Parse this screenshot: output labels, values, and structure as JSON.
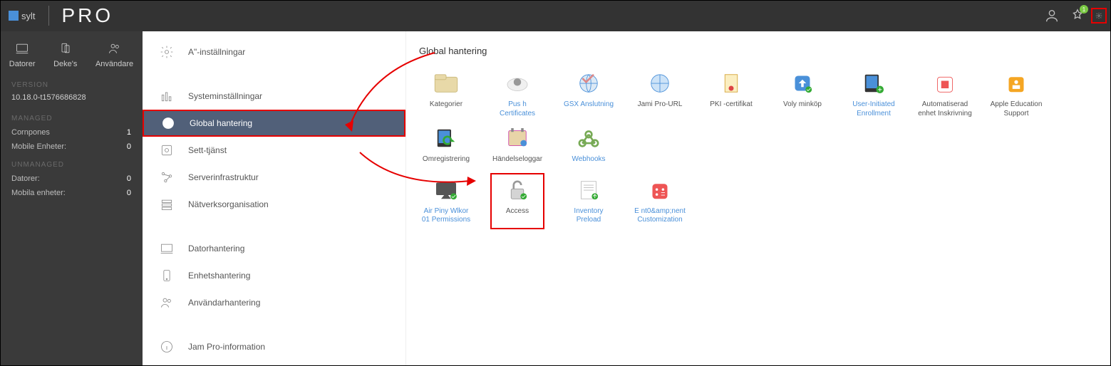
{
  "brand": {
    "logo_text": "sylt",
    "edition": "PRO"
  },
  "topbar": {
    "notif_count": "1"
  },
  "rail": {
    "tabs": [
      {
        "id": "computers",
        "label": "Datorer"
      },
      {
        "id": "devices",
        "label": "Deke's"
      },
      {
        "id": "users",
        "label": "Användare"
      }
    ],
    "version_label": "VERSION",
    "version_value": "10.18.0-t1576686828",
    "managed_label": "MANAGED",
    "managed_stats": [
      {
        "label": "Cornpones",
        "value": "1"
      },
      {
        "label": "Mobile Enheter:",
        "value": "0"
      }
    ],
    "unmanaged_label": "UNMANAGED",
    "unmanaged_stats": [
      {
        "label": "Datorer:",
        "value": "0"
      },
      {
        "label": "Mobila enheter:",
        "value": "0"
      }
    ]
  },
  "nav": {
    "items": [
      {
        "id": "general",
        "label": "A\"-inställningar"
      },
      {
        "id": "system",
        "label": "Systeminställningar"
      },
      {
        "id": "global",
        "label": "Global hantering",
        "active": true
      },
      {
        "id": "self",
        "label": "Sett-tjänst"
      },
      {
        "id": "server",
        "label": "Serverinfrastruktur"
      },
      {
        "id": "network",
        "label": "Nätverksorganisation"
      },
      {
        "id": "computer-mgmt",
        "label": "Datorhantering"
      },
      {
        "id": "device-mgmt",
        "label": "Enhetshantering"
      },
      {
        "id": "user-mgmt",
        "label": "Användarhantering"
      },
      {
        "id": "about",
        "label": "Jam Pro-information"
      }
    ]
  },
  "content": {
    "title": "Global hantering",
    "tiles_row1": [
      {
        "id": "categories",
        "label": "Kategorier"
      },
      {
        "id": "push",
        "label": "Pus h Certificates",
        "blue": true
      },
      {
        "id": "gsx",
        "label": "GSX Anslutning",
        "blue": true
      },
      {
        "id": "jamf-url",
        "label": "Jami Pro-URL"
      },
      {
        "id": "pki",
        "label": "PKI -certifikat"
      },
      {
        "id": "volume",
        "label": "Voly minköp"
      },
      {
        "id": "uie",
        "label": "User-Initiated Enrollment",
        "blue": true
      },
      {
        "id": "auto-enroll",
        "label": "Automatiserad enhet Inskrivning"
      },
      {
        "id": "aes",
        "label": "Apple Education Support"
      },
      {
        "id": "reenroll",
        "label": "Omregistrering"
      },
      {
        "id": "eventlogs",
        "label": "Händelseloggar"
      },
      {
        "id": "webhooks",
        "label": "Webhooks",
        "blue": true
      }
    ],
    "tiles_row2": [
      {
        "id": "airplay",
        "label": "Air Piny\nWlkor 01\nPermissions",
        "blue": true
      },
      {
        "id": "access",
        "label": "Access",
        "highlighted": true
      },
      {
        "id": "inventory",
        "label": "Inventory Preload",
        "blue": true
      },
      {
        "id": "enrollcust",
        "label": "E nt0&amp;nent Customization",
        "blue": true
      }
    ]
  }
}
